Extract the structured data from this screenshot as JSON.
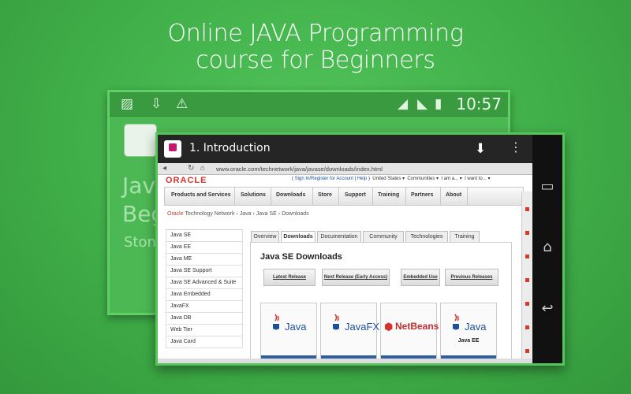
{
  "headline": {
    "line1": "Online JAVA Programming",
    "line2": "course for Beginners"
  },
  "back_phone": {
    "time": "10:57",
    "status_icons": [
      "image-icon",
      "download-icon",
      "warning-icon",
      "wifi-icon",
      "signal-icon",
      "battery-icon"
    ],
    "text_lines": [
      "Jav",
      "Beg",
      "Ston"
    ]
  },
  "front": {
    "title": "1. Introduction",
    "browser": {
      "url": "www.oracle.com/technetwork/java/javase/downloads/index.html",
      "logo": "ORACLE",
      "top_links": {
        "sign_in": "Sign In/Register for Account",
        "help": "Help",
        "country": "United States ▾",
        "communities": "Communities ▾",
        "i_am": "I am a... ▾",
        "i_want": "I want to... ▾"
      },
      "menu": [
        "Products and Services",
        "Solutions",
        "Downloads",
        "Store",
        "Support",
        "Training",
        "Partners",
        "About"
      ],
      "breadcrumb": {
        "oracle": "Oracle",
        "rest": [
          "Technology Network",
          "Java",
          "Java SE",
          "Downloads"
        ]
      },
      "side_nav": [
        "Java SE",
        "Java EE",
        "Java ME",
        "Java SE Support",
        "Java SE Advanced & Suite",
        "Java Embedded",
        "JavaFX",
        "Java DB",
        "Web Tier",
        "Java Card"
      ],
      "tabs": [
        "Overview",
        "Downloads",
        "Documentation",
        "Community",
        "Technologies",
        "Training"
      ],
      "active_tab": "Downloads",
      "content_title": "Java SE Downloads",
      "download_buttons": [
        "Latest Release",
        "Next Release (Early Access)",
        "Embedded Use",
        "Previous Releases"
      ],
      "products": [
        {
          "name": "Java",
          "sub": ""
        },
        {
          "name": "JavaFX",
          "sub": ""
        },
        {
          "name": "NetBeans",
          "sub": ""
        },
        {
          "name": "Java",
          "sub": "Java EE"
        }
      ]
    }
  },
  "colors": {
    "background": "#3fae48",
    "oracle_red": "#d6322a",
    "java_blue": "#1e4f9d"
  }
}
